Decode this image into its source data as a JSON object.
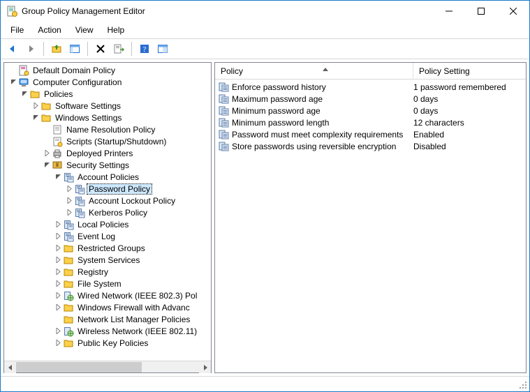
{
  "window": {
    "title": "Group Policy Management Editor"
  },
  "menu": {
    "file": "File",
    "action": "Action",
    "view": "View",
    "help": "Help"
  },
  "columns": {
    "policy": "Policy",
    "setting": "Policy Setting",
    "policy_width": 284,
    "setting_width": 150
  },
  "tree": [
    {
      "depth": 0,
      "exp": "",
      "icon": "scroll",
      "label": "Default Domain Policy"
    },
    {
      "depth": 0,
      "exp": "open",
      "icon": "computer",
      "label": "Computer Configuration"
    },
    {
      "depth": 1,
      "exp": "open",
      "icon": "folder",
      "label": "Policies"
    },
    {
      "depth": 2,
      "exp": "closed",
      "icon": "folder",
      "label": "Software Settings"
    },
    {
      "depth": 2,
      "exp": "open",
      "icon": "folder",
      "label": "Windows Settings"
    },
    {
      "depth": 3,
      "exp": "",
      "icon": "page",
      "label": "Name Resolution Policy"
    },
    {
      "depth": 3,
      "exp": "",
      "icon": "script",
      "label": "Scripts (Startup/Shutdown)"
    },
    {
      "depth": 3,
      "exp": "closed",
      "icon": "printer",
      "label": "Deployed Printers"
    },
    {
      "depth": 3,
      "exp": "open",
      "icon": "security",
      "label": "Security Settings"
    },
    {
      "depth": 4,
      "exp": "open",
      "icon": "policy",
      "label": "Account Policies"
    },
    {
      "depth": 5,
      "exp": "closed",
      "icon": "policy",
      "label": "Password Policy",
      "selected": true
    },
    {
      "depth": 5,
      "exp": "closed",
      "icon": "policy",
      "label": "Account Lockout Policy"
    },
    {
      "depth": 5,
      "exp": "closed",
      "icon": "policy",
      "label": "Kerberos Policy"
    },
    {
      "depth": 4,
      "exp": "closed",
      "icon": "policy",
      "label": "Local Policies"
    },
    {
      "depth": 4,
      "exp": "closed",
      "icon": "policy",
      "label": "Event Log"
    },
    {
      "depth": 4,
      "exp": "closed",
      "icon": "folder",
      "label": "Restricted Groups"
    },
    {
      "depth": 4,
      "exp": "closed",
      "icon": "folder",
      "label": "System Services"
    },
    {
      "depth": 4,
      "exp": "closed",
      "icon": "folder",
      "label": "Registry"
    },
    {
      "depth": 4,
      "exp": "closed",
      "icon": "folder",
      "label": "File System"
    },
    {
      "depth": 4,
      "exp": "closed",
      "icon": "netpol",
      "label": "Wired Network (IEEE 802.3) Pol"
    },
    {
      "depth": 4,
      "exp": "closed",
      "icon": "folder",
      "label": "Windows Firewall with Advanc"
    },
    {
      "depth": 4,
      "exp": "",
      "icon": "folder",
      "label": "Network List Manager Policies"
    },
    {
      "depth": 4,
      "exp": "closed",
      "icon": "netpol",
      "label": "Wireless Network (IEEE 802.11)"
    },
    {
      "depth": 4,
      "exp": "closed",
      "icon": "folder",
      "label": "Public Key Policies"
    }
  ],
  "policies": [
    {
      "name": "Enforce password history",
      "value": "1 password  remembered"
    },
    {
      "name": "Maximum password age",
      "value": "0 days"
    },
    {
      "name": "Minimum password age",
      "value": "0 days"
    },
    {
      "name": "Minimum password length",
      "value": "12 characters"
    },
    {
      "name": "Password must meet complexity requirements",
      "value": "Enabled"
    },
    {
      "name": "Store passwords using reversible encryption",
      "value": "Disabled"
    }
  ]
}
